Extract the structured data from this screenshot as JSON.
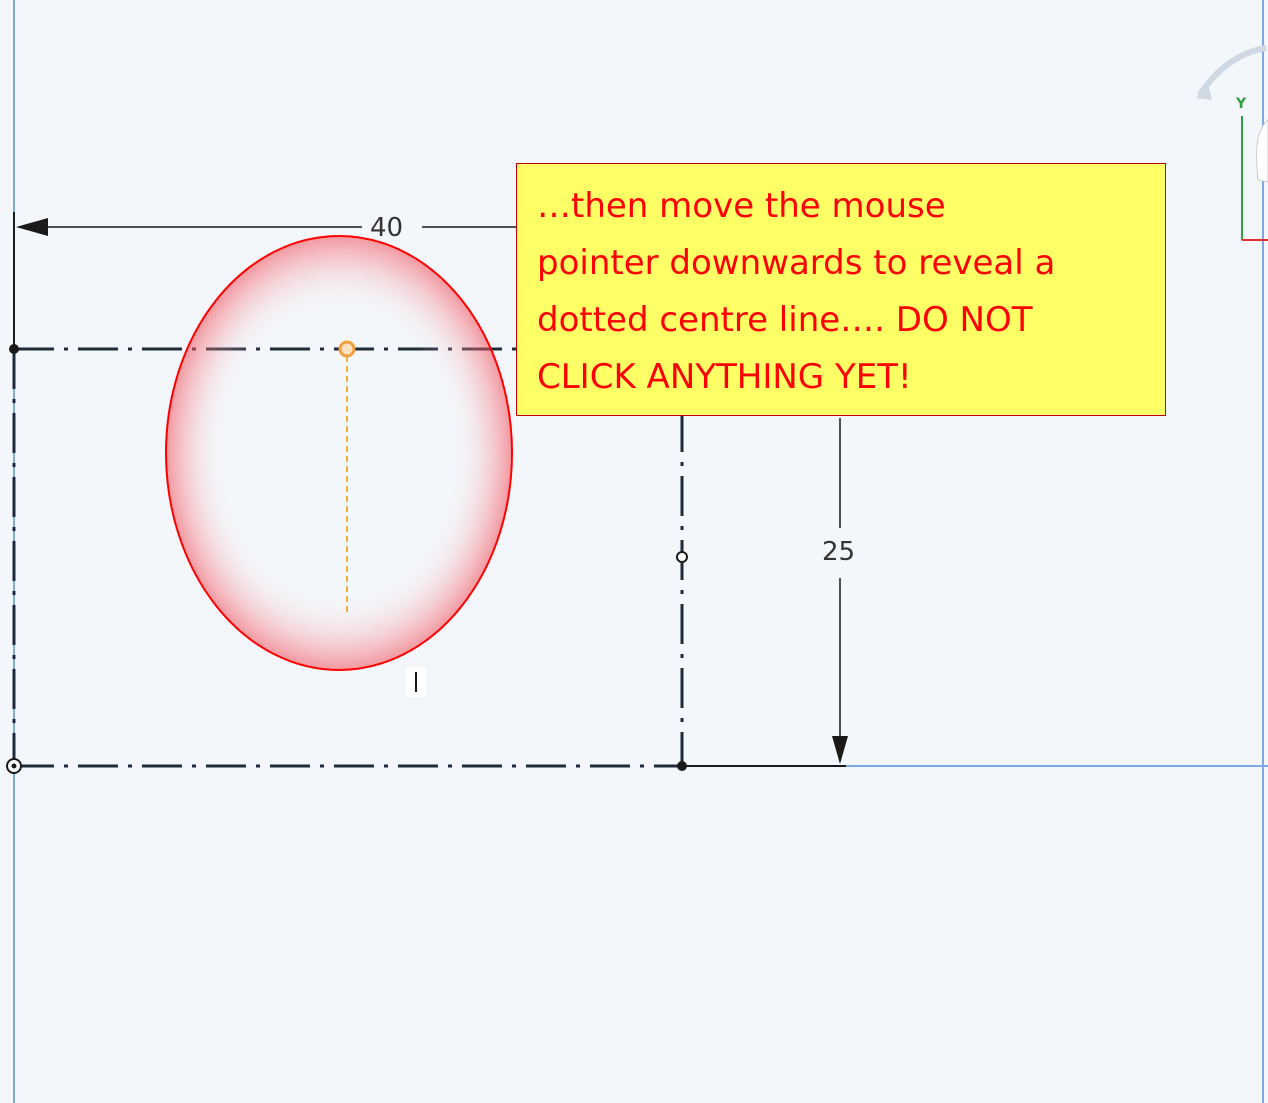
{
  "dimensions": {
    "horizontal_value": "40",
    "vertical_value": "25"
  },
  "view_cube": {
    "y_axis_label": "Y"
  },
  "callout": {
    "text": "…then move the mouse\npointer downwards to reveal a\ndotted centre line…. DO NOT\nCLICK ANYTHING YET!"
  },
  "colors": {
    "canvas_background": "#f3f6fa",
    "sketch_line": "#1a1a1a",
    "construction_line": "#1e2a3a",
    "sketch_axis": "#7fa7e0",
    "callout_fill": "#ffff66",
    "callout_text": "#ff0000",
    "callout_border": "#c00000",
    "highlight_ellipse": "#ff0000",
    "inference_line": "#f0b040"
  },
  "icons": {
    "cursor": "text-cursor-icon",
    "rotate_arrow": "rotate-arrow-icon"
  }
}
